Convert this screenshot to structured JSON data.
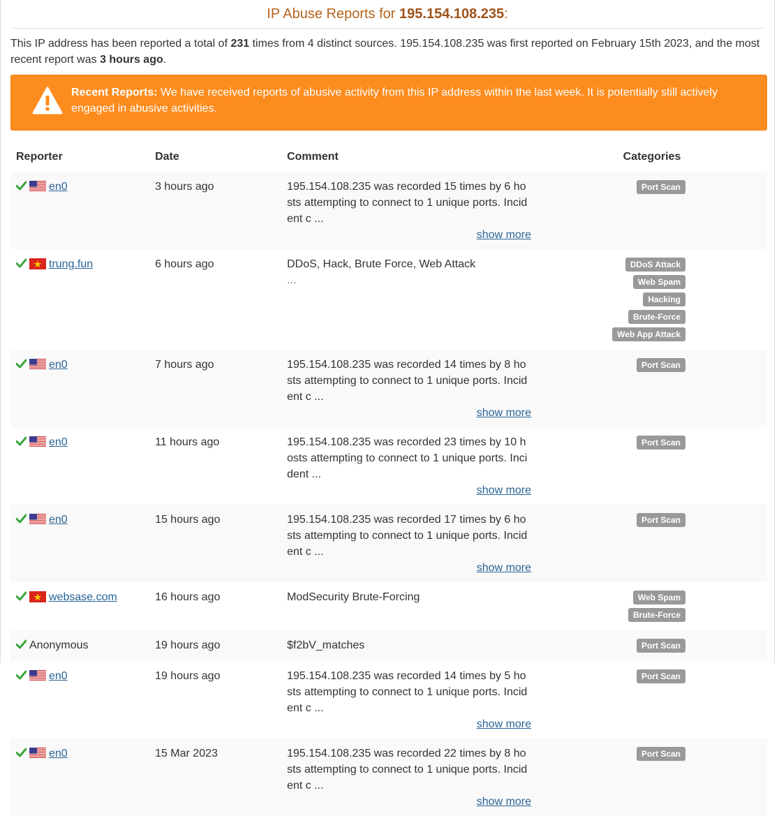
{
  "header": {
    "title_prefix": "IP Abuse Reports for ",
    "ip": "195.154.108.235",
    "title_suffix": ":"
  },
  "summary": {
    "part1": "This IP address has been reported a total of ",
    "count": "231",
    "part2": " times from 4 distinct sources. 195.154.108.235 was first reported on February 15th 2023, and the most recent report was ",
    "recent": "3 hours ago",
    "part3": "."
  },
  "alert": {
    "heading": "Recent Reports:",
    "text": " We have received reports of abusive activity from this IP address within the last week. It is potentially still actively engaged in abusive activities.",
    "color": "#fd8c1e"
  },
  "table": {
    "headers": {
      "reporter": "Reporter",
      "date": "Date",
      "comment": "Comment",
      "categories": "Categories"
    },
    "show_more_label": "show more",
    "rows": [
      {
        "reporter": "en0",
        "flag": "us",
        "link": true,
        "date": "3 hours ago",
        "comment": "195.154.108.235 was recorded 15 times by 6 hosts attempting to connect to 1 unique ports. Incident c ...",
        "show_more": true,
        "categories": [
          "Port Scan"
        ]
      },
      {
        "reporter": "trung.fun",
        "flag": "vn",
        "link": true,
        "date": "6 hours ago",
        "comment": "DDoS, Hack, Brute Force, Web Attack",
        "comment2": "...",
        "show_more": false,
        "categories": [
          "DDoS Attack",
          "Web Spam",
          "Hacking",
          "Brute-Force",
          "Web App Attack"
        ]
      },
      {
        "reporter": "en0",
        "flag": "us",
        "link": true,
        "date": "7 hours ago",
        "comment": "195.154.108.235 was recorded 14 times by 8 hosts attempting to connect to 1 unique ports. Incident c ...",
        "show_more": true,
        "categories": [
          "Port Scan"
        ]
      },
      {
        "reporter": "en0",
        "flag": "us",
        "link": true,
        "date": "11 hours ago",
        "comment": "195.154.108.235 was recorded 23 times by 10 hosts attempting to connect to 1 unique ports. Incident ...",
        "show_more": true,
        "categories": [
          "Port Scan"
        ]
      },
      {
        "reporter": "en0",
        "flag": "us",
        "link": true,
        "date": "15 hours ago",
        "comment": "195.154.108.235 was recorded 17 times by 6 hosts attempting to connect to 1 unique ports. Incident c ...",
        "show_more": true,
        "categories": [
          "Port Scan"
        ]
      },
      {
        "reporter": "websase.com",
        "flag": "vn",
        "link": true,
        "date": "16 hours ago",
        "comment": "ModSecurity Brute-Forcing",
        "show_more": false,
        "categories": [
          "Web Spam",
          "Brute-Force"
        ]
      },
      {
        "reporter": "Anonymous",
        "flag": "",
        "link": false,
        "date": "19 hours ago",
        "comment": "$f2bV_matches",
        "show_more": false,
        "categories": [
          "Port Scan"
        ]
      },
      {
        "reporter": "en0",
        "flag": "us",
        "link": true,
        "date": "19 hours ago",
        "comment": "195.154.108.235 was recorded 14 times by 5 hosts attempting to connect to 1 unique ports. Incident c ...",
        "show_more": true,
        "categories": [
          "Port Scan"
        ]
      },
      {
        "reporter": "en0",
        "flag": "us",
        "link": true,
        "date": "15 Mar 2023",
        "comment": "195.154.108.235 was recorded 22 times by 8 hosts attempting to connect to 1 unique ports. Incident c ...",
        "show_more": true,
        "categories": [
          "Port Scan"
        ]
      }
    ]
  },
  "colors": {
    "title": "#b5651d",
    "link": "#2a6496",
    "check": "#3aa53a",
    "badge": "#999999"
  }
}
